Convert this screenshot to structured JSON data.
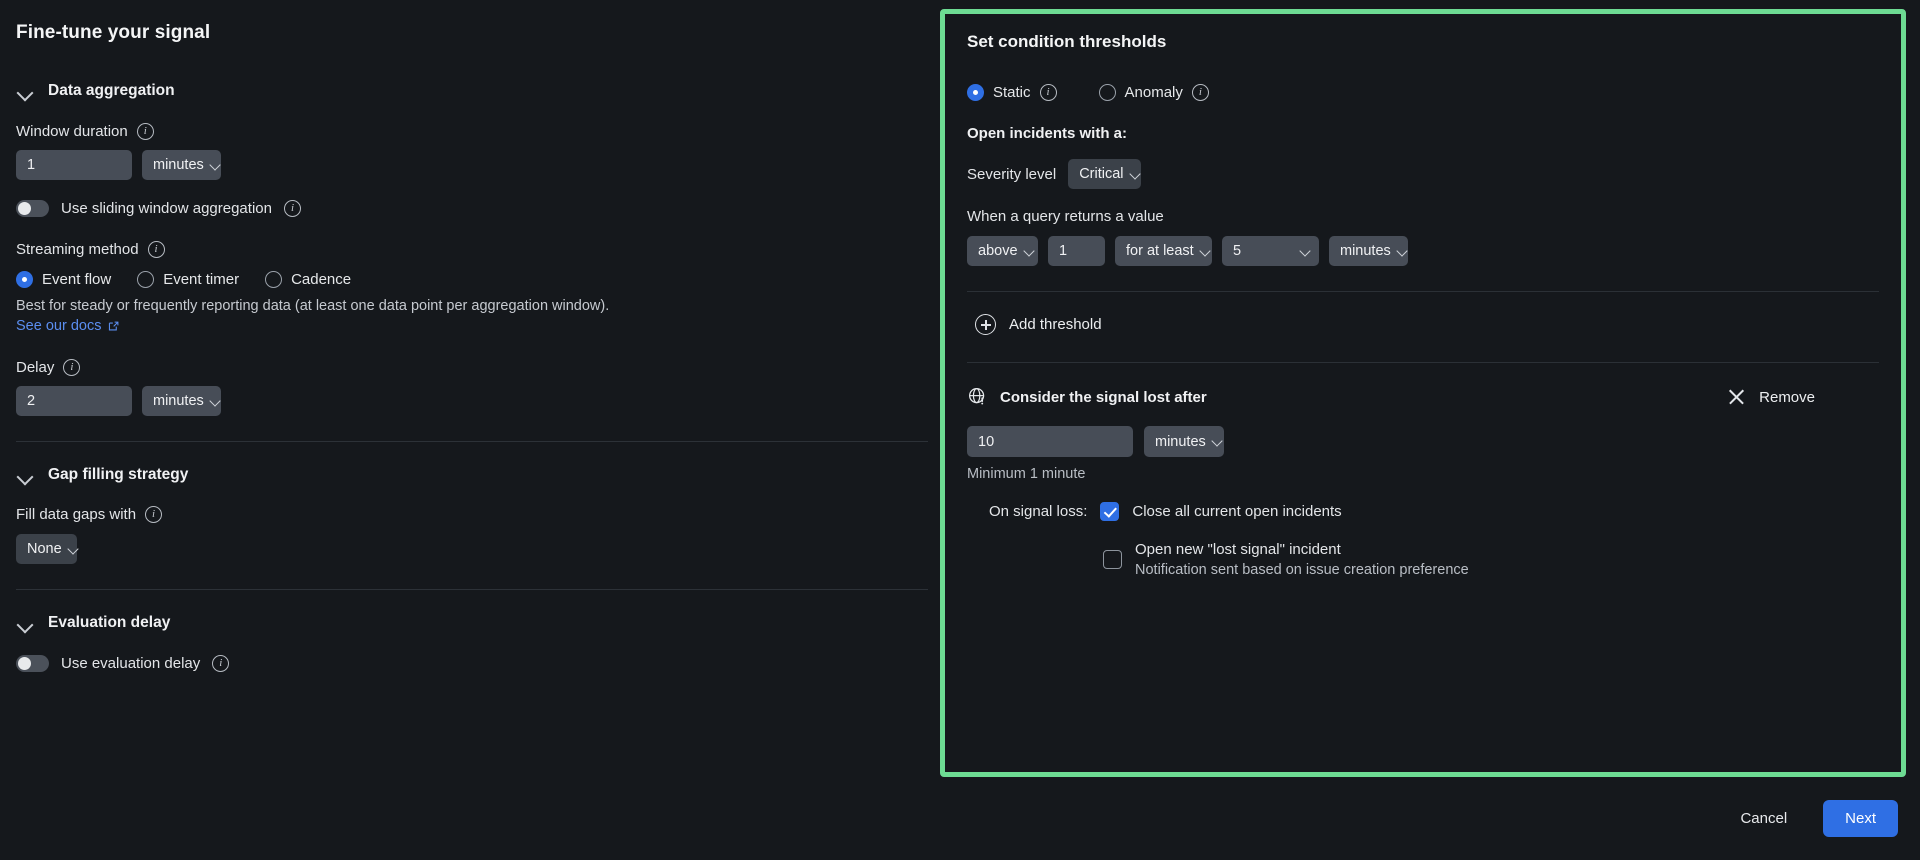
{
  "left": {
    "title": "Fine-tune your signal",
    "data_aggregation": {
      "section_title": "Data aggregation",
      "window_duration_label": "Window duration",
      "window_duration_value": "1",
      "window_duration_unit": "minutes",
      "sliding_toggle_label": "Use sliding window aggregation",
      "streaming_method_label": "Streaming method",
      "streaming_options": [
        {
          "label": "Event flow",
          "selected": true
        },
        {
          "label": "Event timer",
          "selected": false
        },
        {
          "label": "Cadence",
          "selected": false
        }
      ],
      "streaming_help": "Best for steady or frequently reporting data (at least one data point per aggregation window).",
      "docs_link": "See our docs",
      "delay_label": "Delay",
      "delay_value": "2",
      "delay_unit": "minutes"
    },
    "gap_filling": {
      "section_title": "Gap filling strategy",
      "fill_label": "Fill data gaps with",
      "fill_value": "None"
    },
    "evaluation_delay": {
      "section_title": "Evaluation delay",
      "toggle_label": "Use evaluation delay"
    }
  },
  "right": {
    "title": "Set condition thresholds",
    "mode_options": [
      {
        "label": "Static",
        "selected": true
      },
      {
        "label": "Anomaly",
        "selected": false
      }
    ],
    "open_incidents_label": "Open incidents with a:",
    "severity_label": "Severity level",
    "severity_value": "Critical",
    "query_label": "When a query returns a value",
    "condition": {
      "operator": "above",
      "threshold_value": "1",
      "duration_qualifier": "for at least",
      "duration_value": "5",
      "duration_unit": "minutes"
    },
    "add_threshold_label": "Add threshold",
    "signal_lost": {
      "title": "Consider the signal lost after",
      "remove_label": "Remove",
      "value": "10",
      "unit": "minutes",
      "minimum_note": "Minimum 1 minute",
      "on_signal_loss_label": "On signal loss:",
      "close_incidents_label": "Close all current open incidents",
      "close_incidents_checked": true,
      "open_lost_signal_label": "Open new \"lost signal\" incident",
      "open_lost_signal_checked": false,
      "notification_note": "Notification sent based on issue creation preference"
    }
  },
  "footer": {
    "cancel_label": "Cancel",
    "next_label": "Next"
  },
  "colors": {
    "highlight_border": "#6ddb93",
    "accent_blue": "#2f6fe4",
    "background": "#15181c",
    "control_bg": "#474d57",
    "link_blue": "#5b8ef0"
  }
}
